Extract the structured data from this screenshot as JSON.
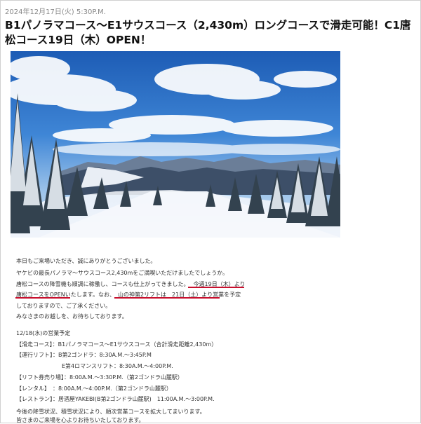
{
  "post": {
    "date": "2024年12月17日(火) 5:30P.M.",
    "title": "B1パノラマコース〜E1サウスコース（2,430m）ロングコースで滑走可能！C1唐松コース19日（木）OPEN！"
  },
  "body": {
    "greeting": "本日もご来場いただき、誠にありがとうございました。",
    "line2": "ヤケビの最長パノラマ〜サウスコース2,430mをご満喫いただけましたでしょうか。",
    "line3a": "唐松コースの降雪機も順調に稼働し、コースも仕上がってきました。",
    "line3b": "今週19日（木）より",
    "line4a": "唐松コースをOPEN",
    "line4b": "いたします。なお、",
    "line4c": "山の神第2リフトは　21日（土）より営業",
    "line4d": "を予定",
    "line5": "しておりますので、ご了承ください。",
    "line6": "みなさまのお越しを、お待ちしております。"
  },
  "schedule": {
    "heading": "12/18(水)の営業予定",
    "course": "【滑走コース】：B1パノラマコース〜E1サウスコース（合計滑走距離2,430m）",
    "lift1": "【運行リフト】：B第2ゴンドラ：8:30A.M.〜3:45P.M",
    "lift2": "E第4ロマンスリフト：8:30A.M.〜4:00P.M.",
    "tickets": "【リフト券売り場】：8:00A.M.〜3:30P.M.（第2ゴンドラ山麓駅）",
    "rental": "【レンタル】　：8:00A.M.〜4:00P.M.（第2ゴンドラ山麓駅）",
    "restaurant": "【レストラン】：居酒屋YAKEBI(B第2ゴンドラ山麓駅)　11:00A.M.〜3:00P.M."
  },
  "footer": {
    "line1": "今後の降雪状況、積雪状況により、順次営業コースを拡大してまいります。",
    "line2": "皆さまのご来場を心よりお待ちいたしております。"
  },
  "colors": {
    "underline": "#c8102e",
    "sky": "#2f6fc2",
    "snow": "#f4f7fb"
  }
}
